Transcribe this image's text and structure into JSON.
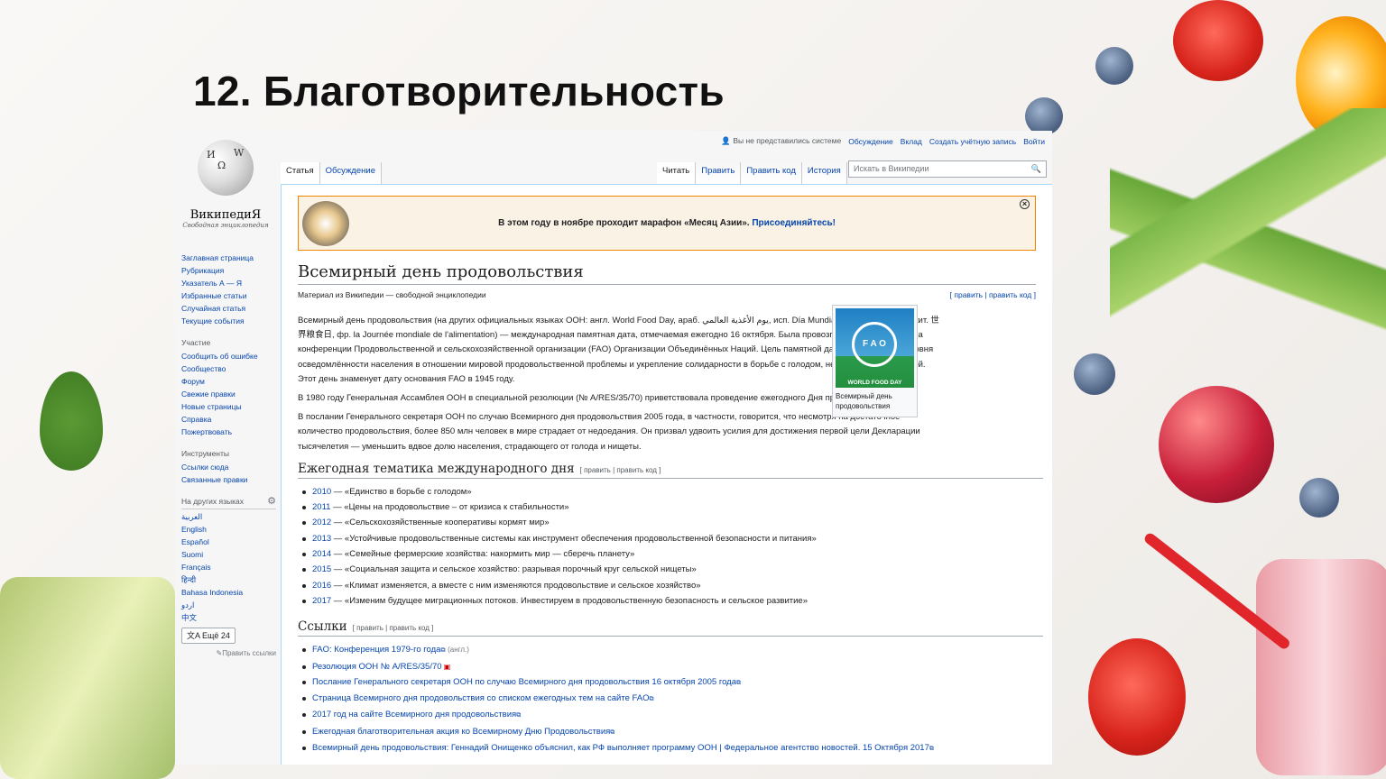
{
  "slide_title": "12. Благотворительность",
  "wiki": {
    "logo_name": "ВикипедиЯ",
    "logo_tagline": "Свободная энциклопедия",
    "nav_main": [
      "Заглавная страница",
      "Рубрикация",
      "Указатель А — Я",
      "Избранные статьи",
      "Случайная статья",
      "Текущие события"
    ],
    "participation_header": "Участие",
    "nav_participation": [
      "Сообщить об ошибке",
      "Сообщество",
      "Форум",
      "Свежие правки",
      "Новые страницы",
      "Справка",
      "Пожертвовать"
    ],
    "tools_header": "Инструменты",
    "nav_tools": [
      "Ссылки сюда",
      "Связанные правки"
    ],
    "languages_header": "На других языках",
    "languages": [
      "العربية",
      "English",
      "Español",
      "Suomi",
      "Français",
      "हिन्दी",
      "Bahasa Indonesia",
      "اردو",
      "中文"
    ],
    "more_languages": "Ещё 24",
    "edit_links": "✎Править ссылки",
    "personal": {
      "anon": "Вы не представились системе",
      "talk": "Обсуждение",
      "contributions": "Вклад",
      "create_account": "Создать учётную запись",
      "login": "Войти"
    },
    "tabs_left": [
      "Статья",
      "Обсуждение"
    ],
    "tabs_right": [
      "Читать",
      "Править",
      "Править код",
      "История"
    ],
    "search_placeholder": "Искать в Википедии",
    "notice_text": "В этом году в ноябре проходит марафон «Месяц Азии».",
    "notice_link": "Присоединяйтесь!",
    "article_title": "Всемирный день продовольствия",
    "from_wiki": "Материал из Википедии — свободной энциклопедии",
    "edit_top": "[ править | править код ]",
    "infobox_logo_text": "F A O",
    "infobox_logo_label": "WORLD FOOD DAY",
    "infobox_caption": "Всемирный день продовольствия",
    "para1": "Всемирный день продовольствия (на других официальных языках ООН: англ. World Food Day, араб. يوم الأغذية العالمي, исп. Día Mundial de la Alimentación, кит. 世界粮食日, фр. la Journée mondiale de l'alimentation) — международная памятная дата, отмечаемая ежегодно 16 октября. Была провозглашена в 1979 году на конференции Продовольственной и сельскохозяйственной организации (FAO) Организации Объединённых Наций. Цель памятной даты — повышение уровня осведомлённости населения в отношении мировой продовольственной проблемы и укрепление солидарности в борьбе с голодом, недоеданием и нищетой. Этот день знаменует дату основания FAO в 1945 году.",
    "para2": "В 1980 году Генеральная Ассамблея ООН в специальной резолюции (№ A/RES/35/70) приветствовала проведение ежегодного Дня продовольствия.",
    "para3": "В послании Генерального секретаря ООН по случаю Всемирного дня продовольствия 2005 года, в частности, говорится, что несмотря на достаточное количество продовольствия, более 850 млн человек в мире страдает от недоедания. Он призвал удвоить усилия для достижения первой цели Декларации тысячелетия — уменьшить вдвое долю населения, страдающего от голода и нищеты.",
    "section1_title": "Ежегодная тематика международного дня",
    "section_edit": "[ править | править код ]",
    "themes": [
      {
        "year": "2010",
        "text": " — «Единство в борьбе с голодом»"
      },
      {
        "year": "2011",
        "text": " — «Цены на продовольствие – от кризиса к стабильности»"
      },
      {
        "year": "2012",
        "text": " — «Сельскохозяйственные кооперативы кормят мир»"
      },
      {
        "year": "2013",
        "text": " — «Устойчивые продовольственные системы как инструмент обеспечения продовольственной безопасности и питания»"
      },
      {
        "year": "2014",
        "text": " — «Семейные фермерские хозяйства: накормить мир — сберечь планету»"
      },
      {
        "year": "2015",
        "text": " — «Социальная защита и сельское хозяйство: разрывая порочный круг сельской нищеты»"
      },
      {
        "year": "2016",
        "text": " — «Климат изменяется, а вместе с ним изменяются продовольствие и сельское хозяйство»"
      },
      {
        "year": "2017",
        "text": " — «Изменим будущее миграционных потоков. Инвестируем в продовольственную безопасность и сельское развитие»"
      }
    ],
    "section2_title": "Ссылки",
    "links": [
      {
        "text": "FAO: Конференция 1979-го года",
        "note": "(англ.)"
      },
      {
        "text": "Резолюция ООН № A/RES/35/70",
        "note": ""
      },
      {
        "text": "Послание Генерального секретаря ООН по случаю Всемирного дня продовольствия 16 октября 2005 года",
        "note": ""
      },
      {
        "text": "Страница Всемирного дня продовольствия со списком ежегодных тем на сайте FAO",
        "note": ""
      },
      {
        "text": "2017 год на сайте Всемирного дня продовольствия",
        "note": ""
      },
      {
        "text": "Ежегодная благотворительная акция ко Всемирному Дню Продовольствия",
        "note": ""
      },
      {
        "text": "Всемирный день продовольствия: Геннадий Онищенко объяснил, как РФ выполняет программу ООН | Федеральное агентство новостей. 15 Октября 2017",
        "note": ""
      }
    ]
  }
}
